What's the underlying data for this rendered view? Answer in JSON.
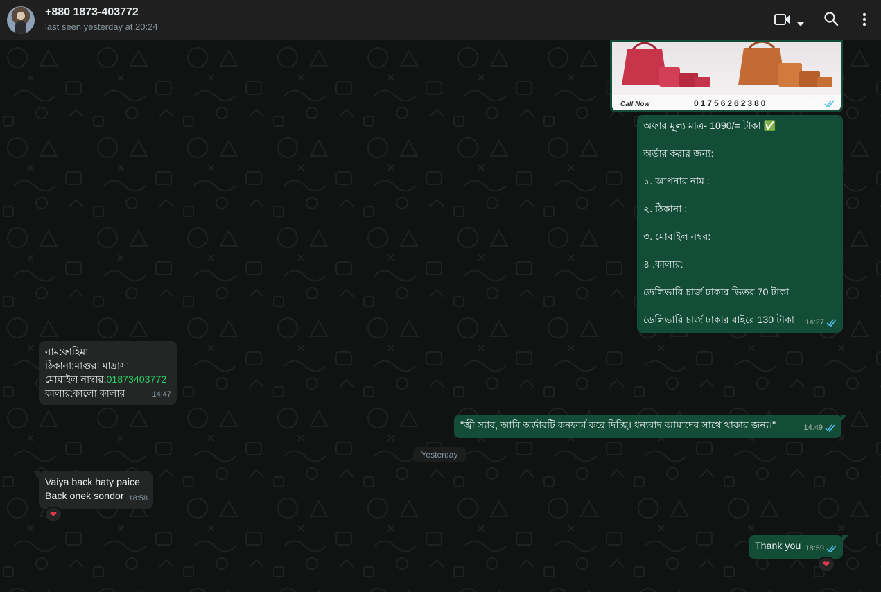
{
  "header": {
    "contact_name": "+880 1873-403772",
    "last_seen": "last seen yesterday at 20:24",
    "icons": [
      "avatar",
      "video-call-icon",
      "chevron-down-icon",
      "search-icon",
      "menu-dots-icon"
    ]
  },
  "image_message": {
    "caption_call": "Call Now",
    "phone_number": "01756262380",
    "time": "14:27"
  },
  "offer_message": {
    "lines": [
      "অফার মূল্য মাত্র- 1090/= টাকা ✅",
      "অর্ডার করার জন্য:",
      "১. আপনার নাম :",
      "২. ঠিকানা :",
      "৩. মোবাইল নম্বর:",
      "৪ .কালার:",
      "ডেলিভারি চার্জ ঢাকার ভিতর 70 টাকা",
      "ডেলিভারি চার্জ ঢাকার বাইরে 130 টাকা"
    ],
    "time": "14:27"
  },
  "customer_order_message": {
    "line1": "নাম:ফাহিমা",
    "line2": "ঠিকানা:মাগুরা মাদ্রাসা",
    "line3_label": "মোবাইল নাম্বার:",
    "line3_phone": "01873403772",
    "line4": "কালার:কালো কালার",
    "time": "14:47"
  },
  "confirm_message": {
    "text": "\"জ্বী স্যার, আমি অর্ডারটি কনফার্ম করে দিচ্ছি। ধন্যবাদ আমাদের সাথে থাকার জন্য।\"",
    "time": "14:49"
  },
  "date_divider": "Yesterday",
  "customer_feedback_message": {
    "line1": "Vaiya back haty paice",
    "line2": "Back onek sondor",
    "time": "18:58",
    "reaction": "❤"
  },
  "thanks_message": {
    "text": "Thank you",
    "time": "18:59",
    "reaction": "❤"
  },
  "colors": {
    "outgoing_bubble": "#144d37",
    "incoming_bubble": "#242626",
    "header_bg": "#1f1f1f",
    "chat_bg": "#111312",
    "read_tick": "#53bdeb",
    "link_green": "#25d366"
  }
}
